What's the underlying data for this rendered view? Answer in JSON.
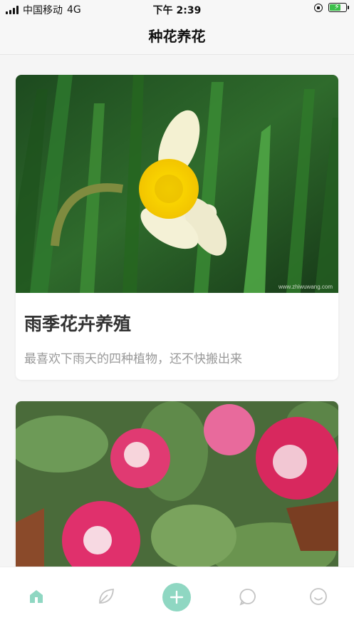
{
  "status_bar": {
    "carrier": "中国移动",
    "network": "4G",
    "time": "下午 2:39",
    "battery_level": 0.75
  },
  "header": {
    "title": "种花养花"
  },
  "cards": [
    {
      "title": "雨季花卉养殖",
      "subtitle": "最喜欢下雨天的四种植物，还不快搬出来",
      "image_watermark": "www.zhiwuwang.com",
      "image_icon": "daffodil-flower"
    },
    {
      "image_icon": "pink-gloxinia-flowers"
    }
  ],
  "tab_bar": {
    "active": "home",
    "accent": "#7fcfb8",
    "inactive": "#c4c4c4",
    "items": [
      "home-icon",
      "leaf-icon",
      "plus-icon",
      "chat-icon",
      "smile-icon"
    ]
  }
}
